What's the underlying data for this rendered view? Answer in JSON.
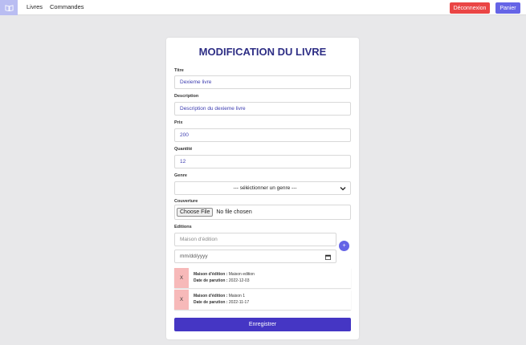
{
  "navbar": {
    "logo_icon": "book-icon",
    "links": [
      "Livres",
      "Commandes"
    ],
    "logout_label": "Déconnexion",
    "cart_label": "Panier"
  },
  "form": {
    "title": "MODIFICATION DU LIVRE",
    "titre_label": "Titre",
    "titre_value": "Dexieme livre",
    "description_label": "Description",
    "description_value": "Description du dexieme livre",
    "prix_label": "Prix",
    "prix_value": "200",
    "quantite_label": "Quantité",
    "quantite_value": "12",
    "genre_label": "Genre",
    "genre_selected": "--- séléctionner un genre ---",
    "couverture_label": "Couverture",
    "file_button": "Choose File",
    "file_status": "No file chosen",
    "editions_label": "Editions",
    "maison_placeholder": "Maison d'édition",
    "date_placeholder": "mm/dd/yyyy",
    "add_button": "+",
    "editions": [
      {
        "remove": "X",
        "maison_key": "Maison d'édition :",
        "maison": " Maison edition",
        "date_key": "Date de parution :",
        "date": " 2022-12-03"
      },
      {
        "remove": "X",
        "maison_key": "Maison d'édition :",
        "maison": " Maison 1",
        "date_key": "Date de parution :",
        "date": " 2022-11-17"
      }
    ],
    "save_label": "Enregistrer"
  },
  "colors": {
    "primary": "#4536c4",
    "accent": "#6564e6",
    "danger": "#ea4545",
    "background": "#e8e8ea"
  }
}
